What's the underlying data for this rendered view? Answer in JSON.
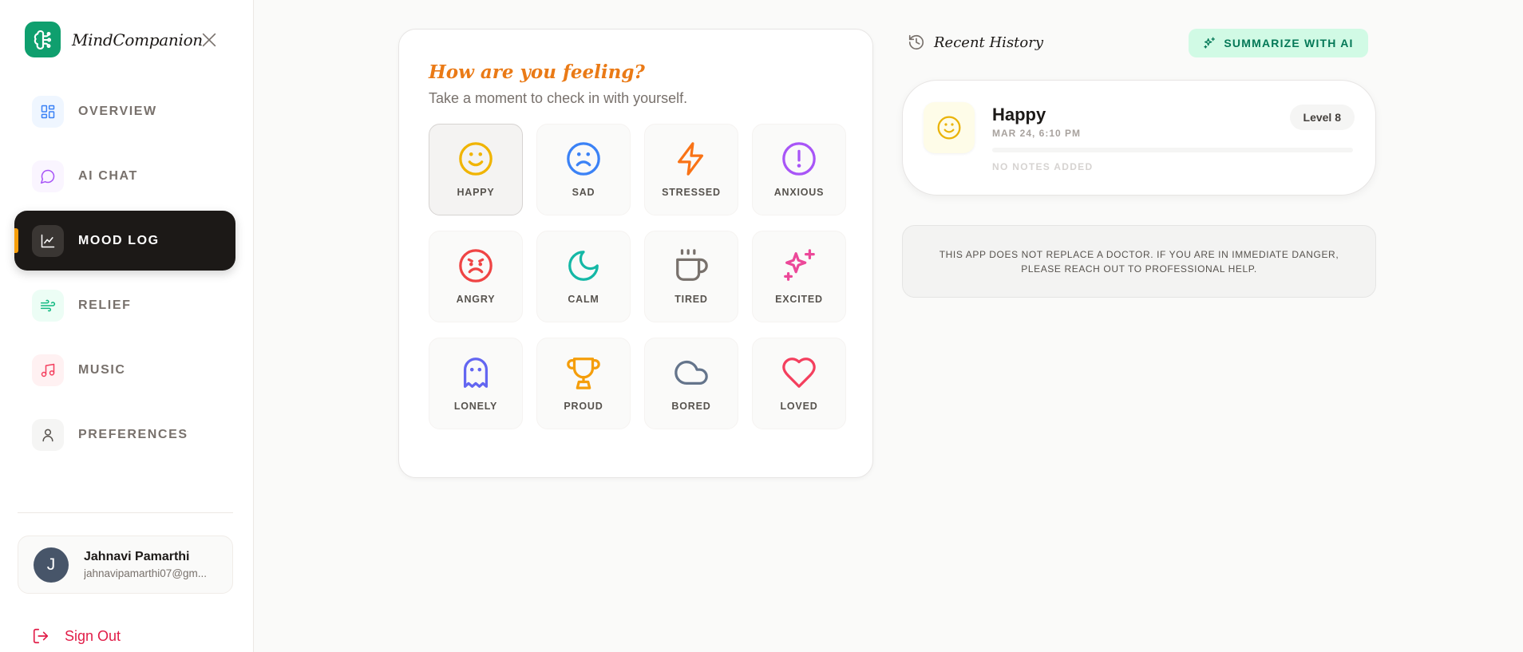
{
  "app": {
    "name": "MindCompanion"
  },
  "sidebar": {
    "items": [
      {
        "label": "OVERVIEW",
        "icon": "grid-icon",
        "active": false
      },
      {
        "label": "AI CHAT",
        "icon": "chat-bubble-icon",
        "active": false
      },
      {
        "label": "MOOD LOG",
        "icon": "line-chart-icon",
        "active": true
      },
      {
        "label": "RELIEF",
        "icon": "wind-icon",
        "active": false
      },
      {
        "label": "MUSIC",
        "icon": "music-note-icon",
        "active": false
      },
      {
        "label": "PREFERENCES",
        "icon": "user-icon",
        "active": false
      }
    ],
    "user": {
      "initial": "J",
      "name": "Jahnavi Pamarthi",
      "email": "jahnavipamarthi07@gm..."
    },
    "signout_label": "Sign Out"
  },
  "mood": {
    "title": "How are you feeling?",
    "subtitle": "Take a moment to check in with yourself.",
    "selected": "HAPPY",
    "options": [
      {
        "label": "HAPPY",
        "icon": "smile-icon",
        "color": "#f0b400"
      },
      {
        "label": "SAD",
        "icon": "frown-icon",
        "color": "#3b82f6"
      },
      {
        "label": "STRESSED",
        "icon": "lightning-icon",
        "color": "#f97316"
      },
      {
        "label": "ANXIOUS",
        "icon": "alert-circle-icon",
        "color": "#a855f7"
      },
      {
        "label": "ANGRY",
        "icon": "angry-face-icon",
        "color": "#ef4444"
      },
      {
        "label": "CALM",
        "icon": "moon-icon",
        "color": "#14b8a6"
      },
      {
        "label": "TIRED",
        "icon": "coffee-cup-icon",
        "color": "#78716c"
      },
      {
        "label": "EXCITED",
        "icon": "sparkles-icon",
        "color": "#ec4899"
      },
      {
        "label": "LONELY",
        "icon": "ghost-icon",
        "color": "#6366f1"
      },
      {
        "label": "PROUD",
        "icon": "trophy-icon",
        "color": "#f59e0b"
      },
      {
        "label": "BORED",
        "icon": "cloud-icon",
        "color": "#64748b"
      },
      {
        "label": "LOVED",
        "icon": "heart-icon",
        "color": "#f43f5e"
      }
    ]
  },
  "history": {
    "title": "Recent History",
    "summarize_label": "SUMMARIZE WITH AI",
    "entries": [
      {
        "mood": "Happy",
        "date": "MAR 24, 6:10 PM",
        "level": "Level 8",
        "notes": "NO NOTES ADDED"
      }
    ]
  },
  "disclaimer": "THIS APP DOES NOT REPLACE A DOCTOR. IF YOU ARE IN IMMEDIATE DANGER, PLEASE REACH OUT TO PROFESSIONAL HELP."
}
